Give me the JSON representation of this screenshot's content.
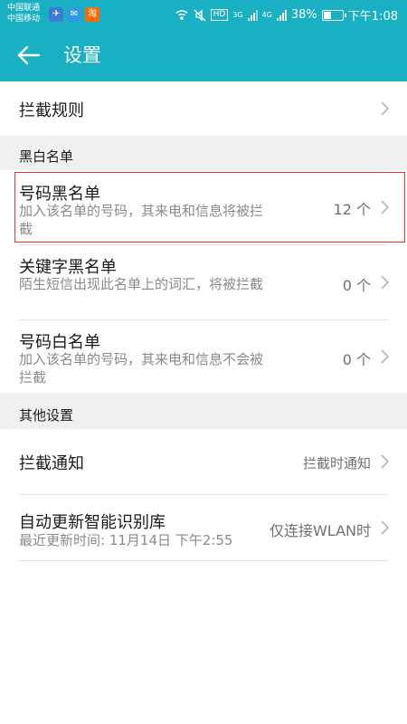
{
  "status_bar": {
    "carrier_1": "中国联通",
    "carrier_2": "中国移动",
    "apps": [
      {
        "icon": "app-icon-blue",
        "glyph": "✈",
        "color": "#3a7bd5"
      },
      {
        "icon": "app-icon-blue-2",
        "glyph": "✉",
        "color": "#2f9be0"
      },
      {
        "icon": "taobao-icon",
        "glyph": "淘",
        "color": "#ff6a00"
      }
    ],
    "hd": "HD",
    "net_3g": "3G",
    "net_4g": "4G",
    "battery_level": 0.38,
    "battery_text": "38%",
    "time": "下午1:08"
  },
  "app_bar": {
    "title": "设置"
  },
  "intercept_rules": {
    "label": "拦截规则"
  },
  "blacklist_section": {
    "title": "黑白名单",
    "items": [
      {
        "title": "号码黑名单",
        "subtitle": "加入该名单的号码，其来电和信息将被拦截",
        "count": "12 个"
      },
      {
        "title": "关键字黑名单",
        "subtitle": "陌生短信出现此名单上的词汇，将被拦截",
        "count": "0 个"
      },
      {
        "title": "号码白名单",
        "subtitle": "加入该名单的号码，其来电和信息不会被拦截",
        "count": "0 个"
      }
    ]
  },
  "other_section": {
    "title": "其他设置",
    "notify": {
      "title": "拦截通知",
      "value": "拦截时通知"
    },
    "update": {
      "title": "自动更新智能识别库",
      "subtitle": "最近更新时间: 11月14日 下午2:55",
      "value": "仅连接WLAN时"
    }
  },
  "colors": {
    "accent": "#1ab0c3",
    "highlight": "#e53935",
    "section_bg": "#f0f0f0"
  }
}
